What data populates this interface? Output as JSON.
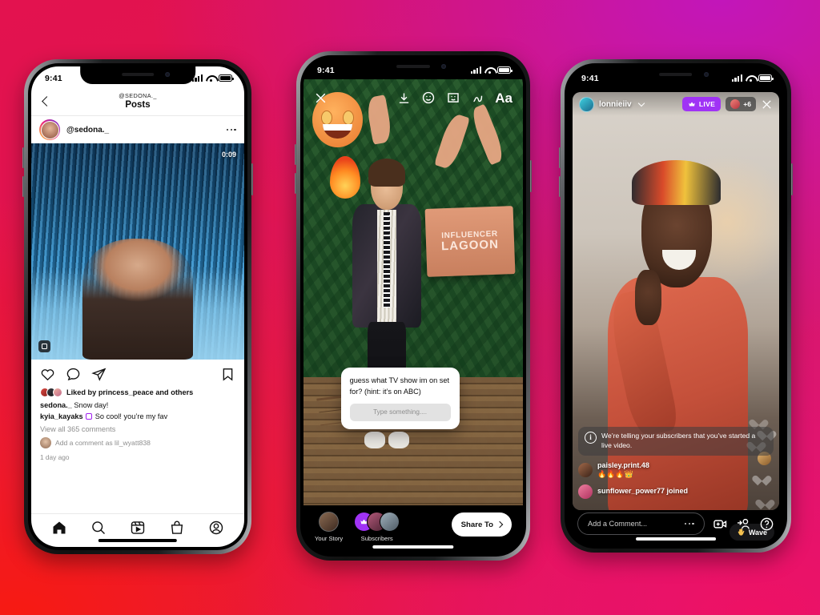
{
  "background": {
    "colors": [
      "#e3124f",
      "#c216ba",
      "#ee1164",
      "#f71a12"
    ]
  },
  "phone1": {
    "name": "instagram-feed-post",
    "status": {
      "time": "9:41"
    },
    "nav": {
      "back_icon": "chevron-left-icon",
      "handle": "@SEDONA._",
      "title": "Posts"
    },
    "post": {
      "username": "@sedona._",
      "more_icon": "more-options-icon",
      "duration": "0:09",
      "actions": {
        "like": "heart-icon",
        "comment": "comment-icon",
        "share": "share-icon",
        "save": "bookmark-icon"
      },
      "liked_by": "Liked by princess_peace and others",
      "caption_user": "sedona._",
      "caption_text": "Snow day!",
      "comment_user": "kyia_kayaks",
      "comment_text": "So cool! you’re my fav",
      "view_comments": "View all 365 comments",
      "add_comment": "Add a comment as lil_wyatt838",
      "timestamp": "1 day ago"
    },
    "tabs": [
      {
        "name": "home",
        "icon": "home-icon"
      },
      {
        "name": "search",
        "icon": "search-icon"
      },
      {
        "name": "reels",
        "icon": "reels-icon"
      },
      {
        "name": "shop",
        "icon": "shop-bag-icon"
      },
      {
        "name": "profile",
        "icon": "profile-icon"
      }
    ]
  },
  "phone2": {
    "name": "instagram-story-editor",
    "status": {
      "time": "9:41"
    },
    "toolbar": [
      {
        "name": "close",
        "icon": "close-x-icon"
      },
      {
        "name": "save",
        "icon": "download-icon"
      },
      {
        "name": "effects",
        "icon": "smiley-face-icon"
      },
      {
        "name": "sticker",
        "icon": "sticker-icon"
      },
      {
        "name": "draw",
        "icon": "scribble-draw-icon"
      },
      {
        "name": "text",
        "icon": "text-aa-icon",
        "label": "Aa"
      }
    ],
    "scene": {
      "sign_line1": "INFLUENCER",
      "sign_line2": "LAGOON"
    },
    "question_sticker": {
      "text": "guess what TV show im on set for? (hint: it’s on ABC)",
      "input_placeholder": "Type something...."
    },
    "share_options": [
      {
        "label": "Your Story",
        "icon": "your-story-avatar"
      },
      {
        "label": "Subscribers",
        "icon": "subscribers-crown-icon"
      }
    ],
    "share_button": {
      "label": "Share To",
      "icon": "chevron-right-icon"
    }
  },
  "phone3": {
    "name": "instagram-live-broadcast",
    "status": {
      "time": "9:41"
    },
    "header": {
      "username": "lonnieiiv",
      "chevron_icon": "chevron-down-icon",
      "live_label": "LIVE",
      "live_icon": "crown-icon",
      "live_color": "#a033f5",
      "viewer_count": "+6",
      "close_icon": "close-x-icon"
    },
    "notice": {
      "icon": "info-icon",
      "text": "We’re telling your subscribers that you’ve started a live video."
    },
    "chat": [
      {
        "user": "paisley.print.48",
        "message": "🔥🔥🔥👑"
      },
      {
        "user": "sunflower_power77 joined",
        "message": ""
      }
    ],
    "wave_button": {
      "label": "Wave",
      "icon": "waving-hand-icon"
    },
    "bottom": {
      "comment_placeholder": "Add a Comment...",
      "more_icon": "more-options-icon",
      "add_video_icon": "add-video-icon",
      "invite_icon": "invite-person-icon",
      "help_icon": "help-question-icon"
    }
  }
}
